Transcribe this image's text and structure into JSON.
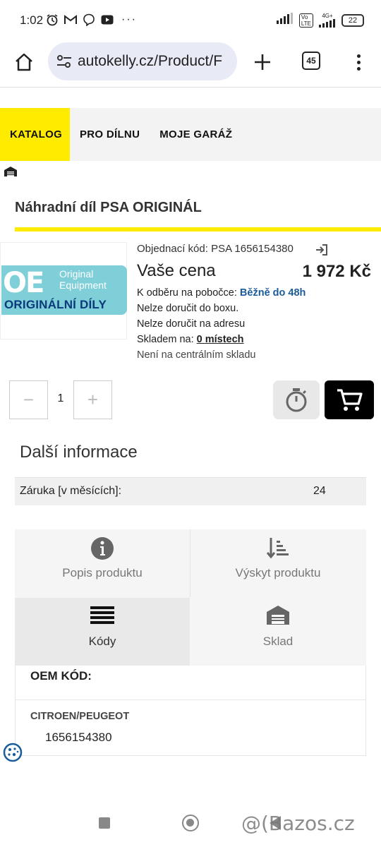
{
  "status_bar": {
    "time": "1:02",
    "battery": "22",
    "network": "4G+"
  },
  "browser": {
    "url": "autokelly.cz/Product/F",
    "tab_count": "45"
  },
  "site_nav": {
    "items": [
      "KATALOG",
      "PRO DÍLNU",
      "MOJE GARÁŽ"
    ]
  },
  "product": {
    "title": "Náhradní díl PSA ORIGINÁL",
    "image": {
      "letters": "OE",
      "line1": "Original",
      "line2": "Equipment",
      "bottom": "ORIGINÁLNÍ DÍLY"
    },
    "order_code": "Objednací kód: PSA 1656154380",
    "price_label": "Vaše cena",
    "price": "1 972 Kč",
    "pickup_label": "K odběru na pobočce:",
    "pickup_value": "Běžně do 48h",
    "no_box": "Nelze doručit do boxu.",
    "no_address": "Nelze doručit na adresu",
    "stock_label": "Skladem na:",
    "stock_value": "0 místech",
    "central": "Není na centrálním skladu",
    "quantity": "1",
    "minus": "−",
    "plus": "+"
  },
  "more_info": {
    "title": "Další informace",
    "warranty_label": "Záruka [v měsících]:",
    "warranty_value": "24"
  },
  "tiles": [
    {
      "label": "Popis produktu",
      "icon": "info-icon"
    },
    {
      "label": "Výskyt produktu",
      "icon": "sort-list-icon"
    },
    {
      "label": "Kódy",
      "icon": "list-icon"
    },
    {
      "label": "Sklad",
      "icon": "warehouse-icon"
    }
  ],
  "oem": {
    "title": "OEM KÓD:",
    "brand": "CITROEN/PEUGEOT",
    "code": "1656154380"
  },
  "watermark": "@(Bazos.cz",
  "colors": {
    "accent_yellow": "#ffeb00",
    "link_blue": "#1a5c99",
    "oe_teal": "#7fcfd9",
    "oe_navy": "#0b3a7a"
  }
}
